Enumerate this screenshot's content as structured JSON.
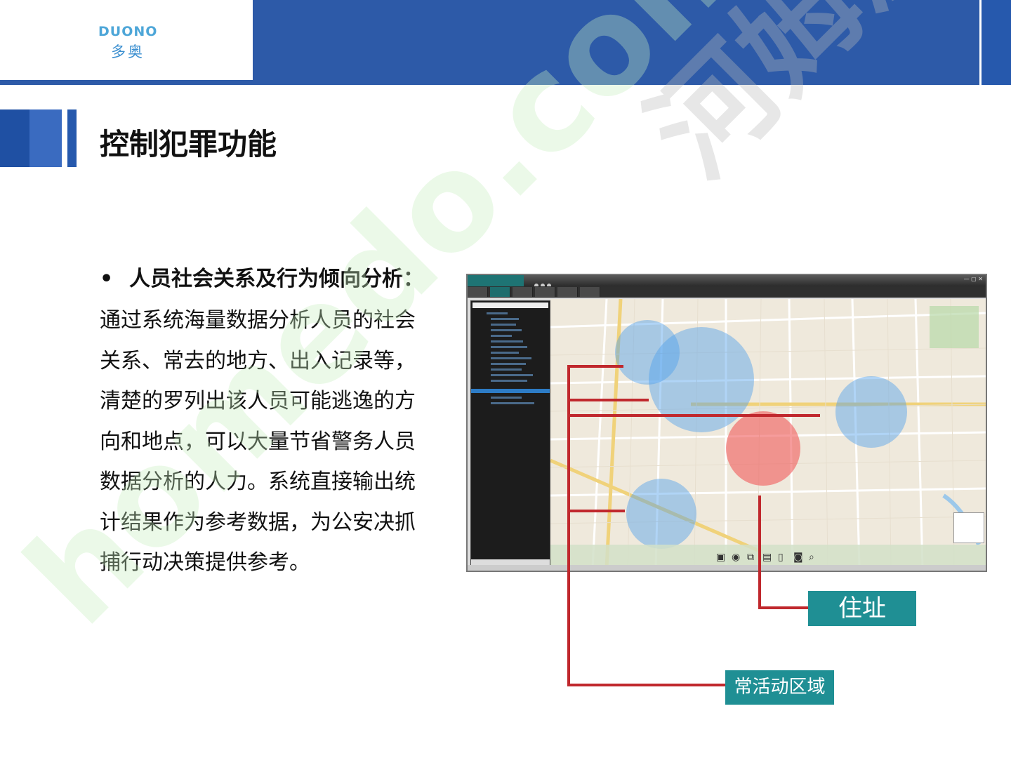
{
  "logo": {
    "mark": "DUONO",
    "text": "多奥",
    "icon": "duono-logo-icon"
  },
  "title": "控制犯罪功能",
  "bullet": {
    "heading": "人员社会关系及行为倾向分析：",
    "lines": [
      "通过系统海量数据分析人员的社会",
      "关系、常去的地方、出入记录等，",
      "清楚的罗列出该人员可能逃逸的方",
      "向和地点，可以大量节省警务人员",
      "数据分析的人力。系统直接输出统",
      "计结果作为参考数据，为公安决抓",
      "捕行动决策提供参考。"
    ]
  },
  "callouts": {
    "address": "住址",
    "frequent_area": "常活动区域"
  },
  "watermarks": [
    "homedo.com",
    "河姆渡"
  ],
  "colors": {
    "header": "#2d5aa8",
    "accent": "#1f8f94",
    "line": "#c0282d"
  }
}
